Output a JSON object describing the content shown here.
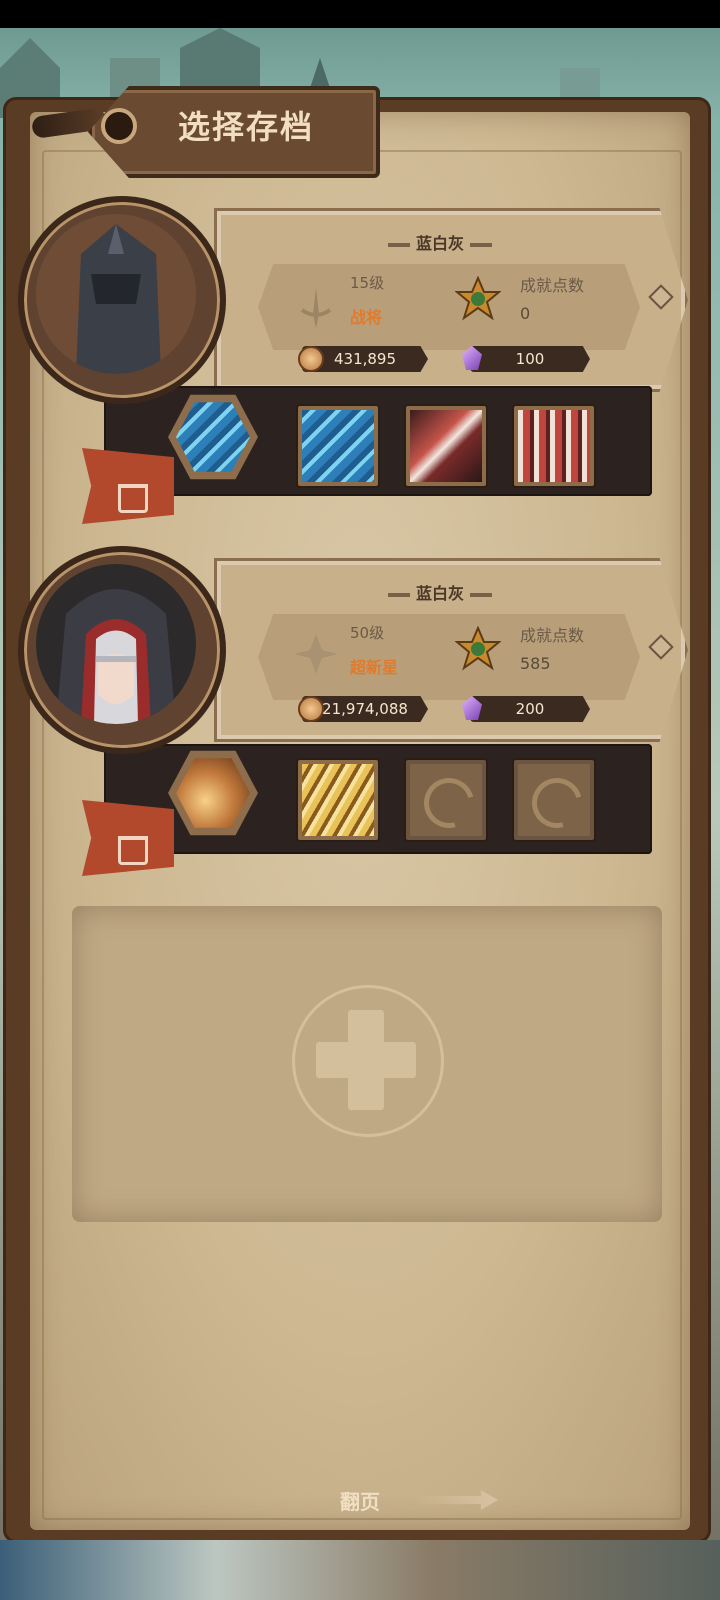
{
  "header": {
    "title": "选择存档"
  },
  "slots": [
    {
      "name": "蓝白灰",
      "level": "15级",
      "rank": "战将",
      "achievement_label": "成就点数",
      "achievement_value": "0",
      "coins": "431,895",
      "gems": "100",
      "skills": [
        "blue-blades",
        "blue-slash",
        "red-claw",
        "red-spikes"
      ]
    },
    {
      "name": "蓝白灰",
      "level": "50级",
      "rank": "超新星",
      "achievement_label": "成就点数",
      "achievement_value": "585",
      "coins": "21,974,088",
      "gems": "200",
      "skills": [
        "gold-burst",
        "gold-strike",
        "locked",
        "locked"
      ]
    }
  ],
  "footer": {
    "page_label": "翻页"
  },
  "colors": {
    "rank": "#e07b2c",
    "trash": "#b2482c",
    "panel": "#c7b08a"
  }
}
